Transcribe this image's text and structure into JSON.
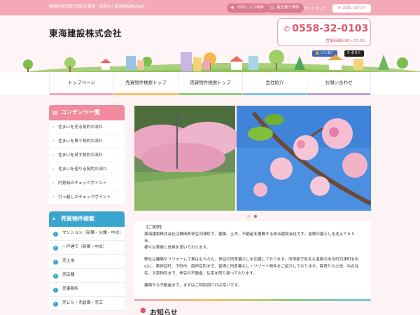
{
  "topbar": {
    "tagline": "静岡県賀茂郡河津町の賃貸・売買なら東海建設株式会社",
    "favorites_label": "お気に入り物件",
    "recent_label": "最近見た物件",
    "sitemap_label": "サイトマップ",
    "contact_label": "お問い合わせ"
  },
  "header": {
    "company_name": "東海建設株式会社",
    "phone": "0558-32-0103",
    "hours": "営業時間9:00～17:30",
    "like_label": "いいね！",
    "post_label": "ポスト"
  },
  "nav": {
    "items": [
      {
        "label": "トップページ",
        "color": "#f3a9b6"
      },
      {
        "label": "売買物件検索トップ",
        "color": "#f7c46b"
      },
      {
        "label": "賃貸物件検索トップ",
        "color": "#8ccf7e"
      },
      {
        "label": "会社紹介",
        "color": "#7fc6e2"
      },
      {
        "label": "お問い合わせ",
        "color": "#b9a3d9"
      }
    ]
  },
  "sidebar": {
    "contents_title": "コンテンツ一覧",
    "contents_items": [
      "住まいを売る契約の流れ",
      "住まいを買う契約の流れ",
      "住まいを貸す契約の流れ",
      "住まいを借りる契約の流れ",
      "内見時のチェックポイント",
      "引っ越しのチェックポイント"
    ],
    "sale_title": "売買物件検索",
    "sale_items": [
      "マンション（新築・分譲・中古）",
      "一戸建て（新築・中古）",
      "売土地",
      "売店舗",
      "売事務所",
      "売ビル・売倉庫・売工"
    ]
  },
  "greeting": {
    "lines": [
      "【ご挨拶】",
      "東海建設株式会社は静岡県伊豆河津町で、建築、土木、不動産を展開する総合建設会社です。皆様の暮らしを支えて６５年、",
      "様々な実績と信用を頂いております。",
      "",
      "弊社は建築やリフォーム工事はもちろん、伊豆の田舎暮らしを応援しております。河津桜で有名な温泉のある町河津町を中心に、東伊豆町、下田市、南伊豆町まで、皆様に田舎暮らし・リゾート物件をご紹介しております。賃貸から土地、中古住宅、大型物件まで、伊豆の不動産、住宅を取り扱っております。",
      "",
      "建築から不動産まで、まずはご相談頂ければ幸いです。"
    ]
  },
  "news": {
    "title": "お知らせ"
  },
  "colors": {
    "accent_pink": "#f3a9b6",
    "phone_red": "#e0556d",
    "sidebar_blue": "#3aa6cf"
  }
}
